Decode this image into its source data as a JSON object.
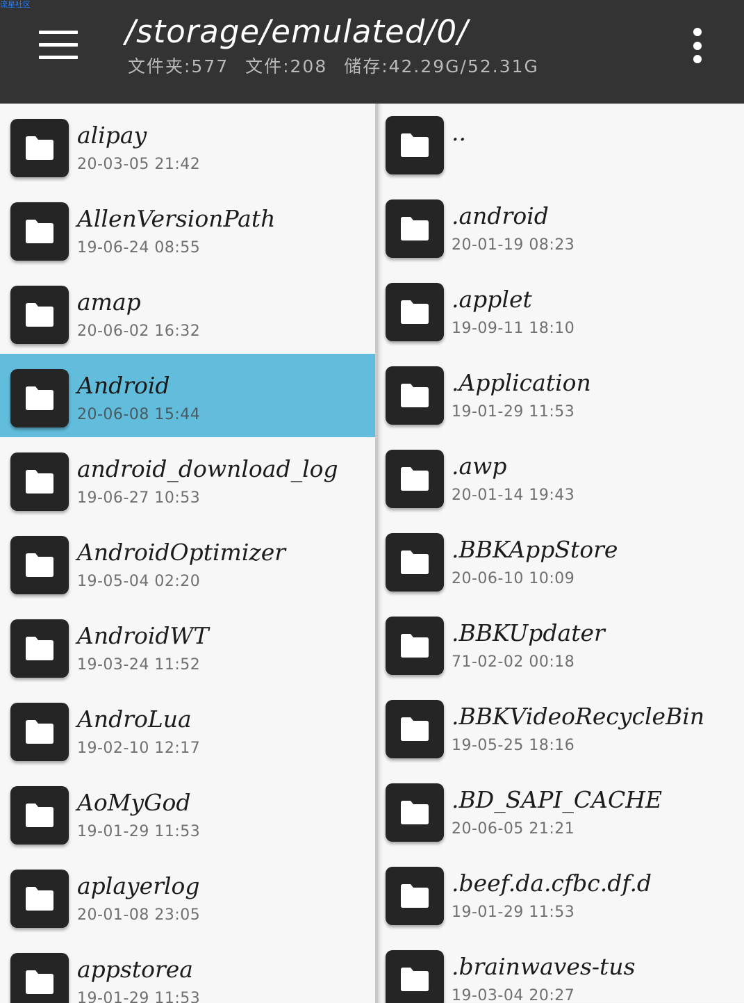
{
  "watermark": "流星社区",
  "header": {
    "path": "/storage/emulated/0/",
    "folders_label": "文件夹:577",
    "files_label": "文件:208",
    "storage_label": "储存:42.29G/52.31G"
  },
  "colors": {
    "appbar": "#333333",
    "selected_row": "#62bddd",
    "folder_icon_bg": "#252525"
  },
  "left_pane": {
    "items": [
      {
        "name": "alipay",
        "date": "20-03-05 21:42"
      },
      {
        "name": "AllenVersionPath",
        "date": "19-06-24 08:55"
      },
      {
        "name": "amap",
        "date": "20-06-02 16:32"
      },
      {
        "name": "Android",
        "date": "20-06-08 15:44",
        "selected": true
      },
      {
        "name": "android_download_log",
        "date": "19-06-27 10:53"
      },
      {
        "name": "AndroidOptimizer",
        "date": "19-05-04 02:20"
      },
      {
        "name": "AndroidWT",
        "date": "19-03-24 11:52"
      },
      {
        "name": "AndroLua",
        "date": "19-02-10 12:17"
      },
      {
        "name": "AoMyGod",
        "date": "19-01-29 11:53"
      },
      {
        "name": "aplayerlog",
        "date": "20-01-08 23:05"
      },
      {
        "name": "appstorea",
        "date": "19-01-29 11:53"
      }
    ]
  },
  "right_pane": {
    "items": [
      {
        "name": "..",
        "date": ""
      },
      {
        "name": ".android",
        "date": "20-01-19 08:23"
      },
      {
        "name": ".applet",
        "date": "19-09-11 18:10"
      },
      {
        "name": ".Application",
        "date": "19-01-29 11:53"
      },
      {
        "name": ".awp",
        "date": "20-01-14 19:43"
      },
      {
        "name": ".BBKAppStore",
        "date": "20-06-10 10:09"
      },
      {
        "name": ".BBKUpdater",
        "date": "71-02-02 00:18"
      },
      {
        "name": ".BBKVideoRecycleBin",
        "date": "19-05-25 18:16"
      },
      {
        "name": ".BD_SAPI_CACHE",
        "date": "20-06-05 21:21"
      },
      {
        "name": ".beef.da.cfbc.df.d",
        "date": "19-01-29 11:53"
      },
      {
        "name": ".brainwaves-tus",
        "date": "19-03-04 20:27"
      }
    ]
  }
}
